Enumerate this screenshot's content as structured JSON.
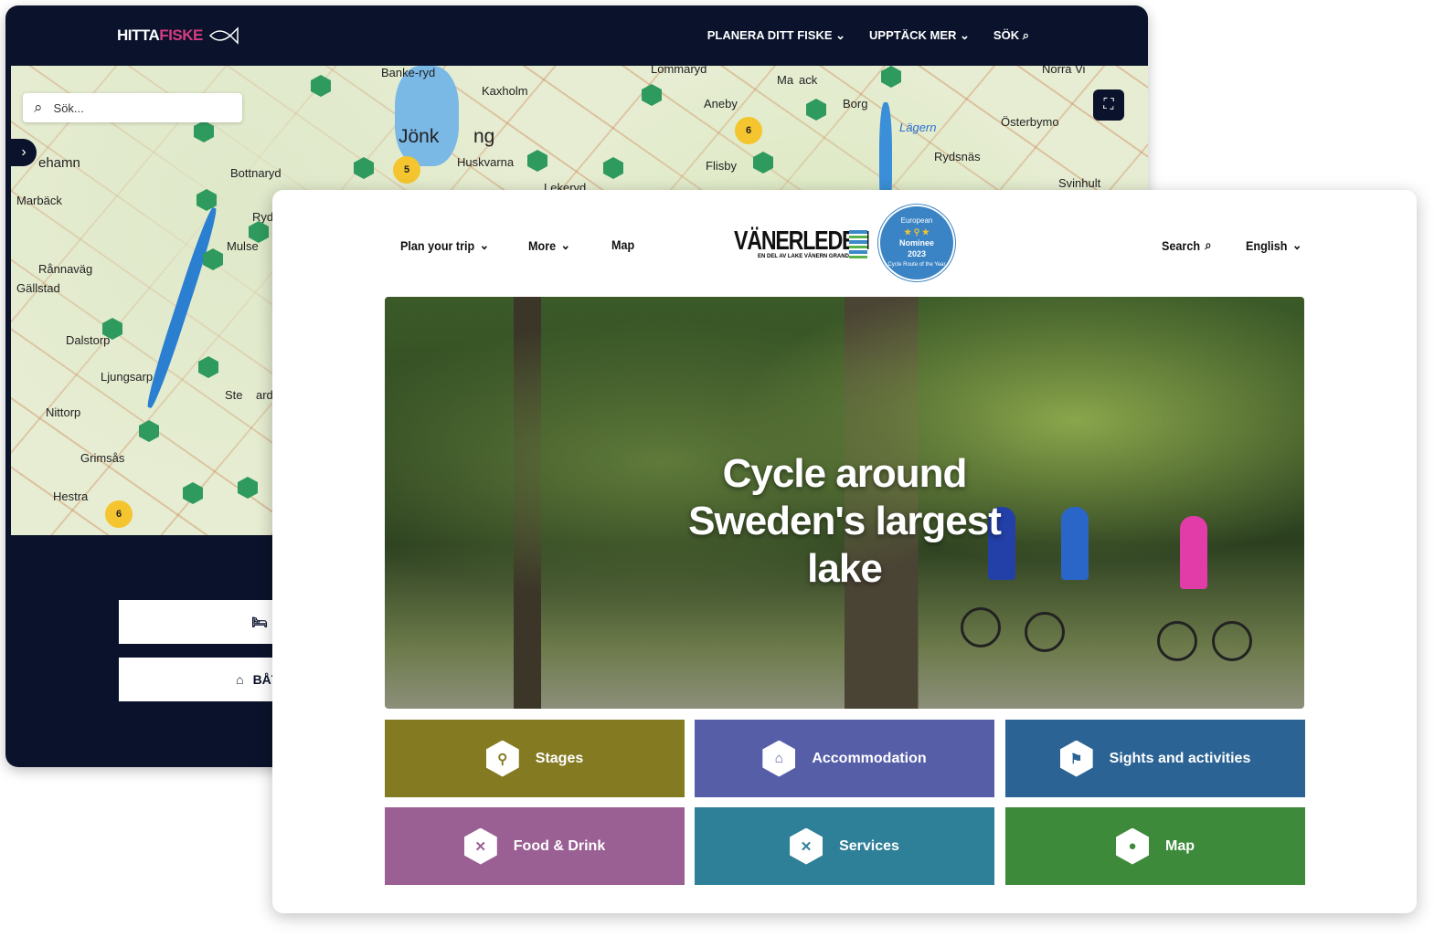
{
  "hittafiske": {
    "logo_a": "HITTA",
    "logo_b": "FISKE",
    "nav": [
      "PLANERA DITT FISKE",
      "UPPTÄCK MER",
      "SÖK"
    ],
    "search_placeholder": "Sök...",
    "places": [
      "Banke-ryd",
      "Jönk",
      "ng",
      "Kaxholm",
      "Lommaryd",
      "Ma",
      "ack",
      "Aneby",
      "Borg",
      "Lägern",
      "Österbymo",
      "Norra Vi",
      "Huskvarna",
      "Lekeryd",
      "Flisby",
      "Rydsnäs",
      "Svinhult",
      "ehamn",
      "Bottnaryd",
      "Marbäck",
      "Ryd",
      "Mulse",
      "Rånnaväg",
      "Gällstad",
      "Dalstorp",
      "Ljungsarp",
      "Ste",
      "ards",
      "Nittorp",
      "Grimsås",
      "Hestra"
    ],
    "clusters": [
      "5",
      "6",
      "6"
    ],
    "buttons": [
      "BO",
      "BÅTUT"
    ],
    "colors": {
      "navy": "#0a132b",
      "pink": "#d63c82",
      "pin": "#2f9a5e",
      "cluster": "#f4c52f"
    }
  },
  "vanerleden": {
    "nav": {
      "plan": "Plan your trip",
      "more": "More",
      "map": "Map",
      "search": "Search",
      "language": "English"
    },
    "brand": {
      "name": "VÄNERLEDEN",
      "tagline": "EN DEL AV LAKE VÄNERN GRAND TOUR"
    },
    "badge": {
      "top": "European",
      "nominee": "Nominee",
      "year": "2023",
      "bottom": "Cycle Route of the Year"
    },
    "hero_title": "Cycle around Sweden's largest lake",
    "tiles": [
      {
        "label": "Stages",
        "icon": "bicycle-icon",
        "color": "#847a22"
      },
      {
        "label": "Accommodation",
        "icon": "house-icon",
        "color": "#565ea8"
      },
      {
        "label": "Sights and activities",
        "icon": "signpost-icon",
        "color": "#2b6394"
      },
      {
        "label": "Food & Drink",
        "icon": "cutlery-icon",
        "color": "#9a5f93"
      },
      {
        "label": "Services",
        "icon": "tools-icon",
        "color": "#2e7f98"
      },
      {
        "label": "Map",
        "icon": "map-pin-icon",
        "color": "#3c8a3a"
      }
    ]
  }
}
